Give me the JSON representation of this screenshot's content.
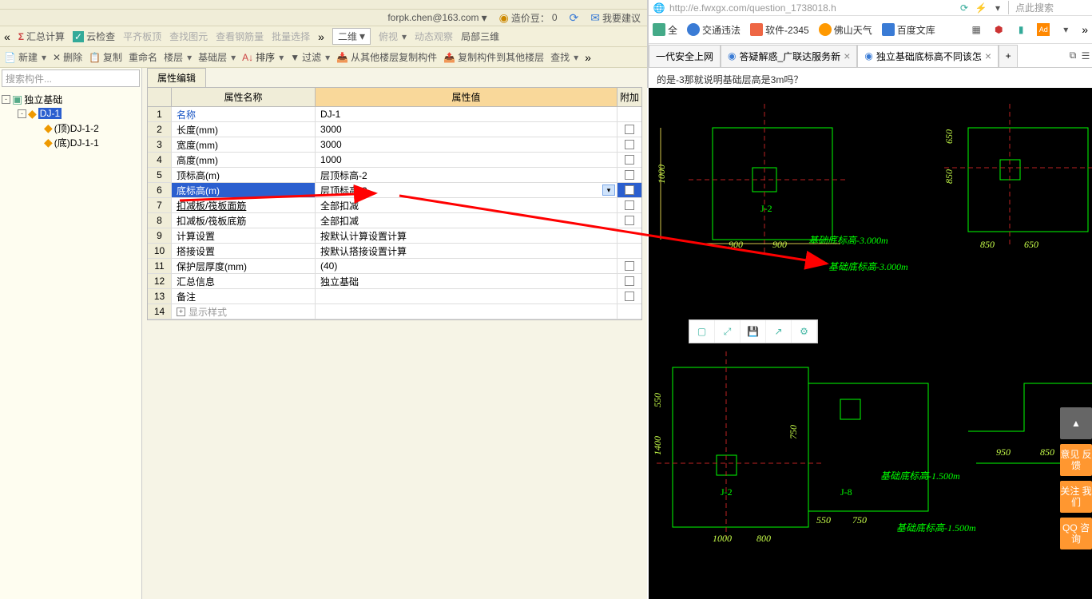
{
  "browser": {
    "url": "http://e.fwxgx.com/question_1738018.h",
    "search_placeholder": "点此搜索",
    "favorites": [
      {
        "label": "全",
        "color": "#4a8"
      },
      {
        "label": "交通违法",
        "color": "#3a7bd5"
      },
      {
        "label": "软件-2345",
        "color": "#e64"
      },
      {
        "label": "佛山天气",
        "color": "#f90"
      },
      {
        "label": "百度文库",
        "color": "#3a7bd5"
      }
    ],
    "tabs": [
      {
        "label": "一代安全上网"
      },
      {
        "label": "答疑解惑_广联达服务新"
      },
      {
        "label": "独立基础底标高不同该怎"
      }
    ],
    "question": "的是-3那就说明基础层高是3m吗？"
  },
  "app": {
    "info_bar": {
      "email": "forpk.chen@163.com",
      "beans_label": "造价豆：",
      "beans": "0",
      "suggest": "我要建议"
    },
    "toolbar1": [
      {
        "label": "汇总计算",
        "icon": "Σ"
      },
      {
        "label": "云检查",
        "icon": "✓"
      },
      {
        "label": "平齐板顶",
        "disabled": true
      },
      {
        "label": "查找图元",
        "disabled": true
      },
      {
        "label": "查看钢筋量",
        "disabled": true
      },
      {
        "label": "批量选择",
        "disabled": true
      },
      {
        "label": "二维"
      },
      {
        "label": "俯视"
      },
      {
        "label": "动态观察",
        "disabled": true
      },
      {
        "label": "局部三维"
      }
    ],
    "toolbar2": [
      {
        "label": "新建"
      },
      {
        "label": "删除"
      },
      {
        "label": "复制"
      },
      {
        "label": "重命名"
      },
      {
        "label": "楼层"
      },
      {
        "label": "基础层"
      },
      {
        "label": "排序"
      },
      {
        "label": "过滤"
      },
      {
        "label": "从其他楼层复制构件"
      },
      {
        "label": "复制构件到其他楼层"
      },
      {
        "label": "查找"
      }
    ],
    "tree": {
      "search_placeholder": "搜索构件...",
      "root": "独立基础",
      "selected": "DJ-1",
      "children": [
        {
          "label": "(顶)DJ-1-2"
        },
        {
          "label": "(底)DJ-1-1"
        }
      ]
    },
    "prop": {
      "tab": "属性编辑",
      "headers": {
        "name": "属性名称",
        "value": "属性值",
        "att": "附加"
      },
      "rows": [
        {
          "n": "1",
          "name": "名称",
          "value": "DJ-1",
          "link": true,
          "chk": false
        },
        {
          "n": "2",
          "name": "长度(mm)",
          "value": "3000",
          "chk": true
        },
        {
          "n": "3",
          "name": "宽度(mm)",
          "value": "3000",
          "chk": true
        },
        {
          "n": "4",
          "name": "高度(mm)",
          "value": "1000",
          "chk": true
        },
        {
          "n": "5",
          "name": "顶标高(m)",
          "value": "层顶标高-2",
          "chk": true
        },
        {
          "n": "6",
          "name": "底标高(m)",
          "value": "层顶标高-3",
          "chk": true,
          "selected": true,
          "dd": true
        },
        {
          "n": "7",
          "name": "扣减板/筏板面筋",
          "value": "全部扣减",
          "chk": true,
          "underline": true
        },
        {
          "n": "8",
          "name": "扣减板/筏板底筋",
          "value": "全部扣减",
          "chk": true
        },
        {
          "n": "9",
          "name": "计算设置",
          "value": "按默认计算设置计算",
          "chk": false
        },
        {
          "n": "10",
          "name": "搭接设置",
          "value": "按默认搭接设置计算",
          "chk": false
        },
        {
          "n": "11",
          "name": "保护层厚度(mm)",
          "value": "(40)",
          "chk": true
        },
        {
          "n": "12",
          "name": "汇总信息",
          "value": "独立基础",
          "chk": true
        },
        {
          "n": "13",
          "name": "备注",
          "value": "",
          "chk": true
        },
        {
          "n": "14",
          "name": "显示样式",
          "value": "",
          "expand": true,
          "gray": true
        }
      ]
    }
  },
  "cad": {
    "labels": {
      "j2a": "J-2",
      "j2b": "J-2",
      "j8": "J-8",
      "elev1": "基础底标高-3.000m",
      "elev2": "基础底标高-3.000m",
      "elev3": "基础底标高-1.500m",
      "elev4": "基础底标高-1.500m"
    },
    "dims": {
      "d1000": "1000",
      "d900a": "900",
      "d900b": "900",
      "d850a": "850",
      "d650": "650",
      "d850b": "850",
      "d650b": "650",
      "d550a": "550",
      "d1400": "1400",
      "d750": "750",
      "d950": "950",
      "d850c": "850",
      "d550b": "550",
      "d750b": "750",
      "d1000b": "1000",
      "d800": "800"
    }
  },
  "side": {
    "top": "▲",
    "feedback": "意见\n反馈",
    "follow": "关注\n我们",
    "qq": "QQ\n咨询"
  }
}
